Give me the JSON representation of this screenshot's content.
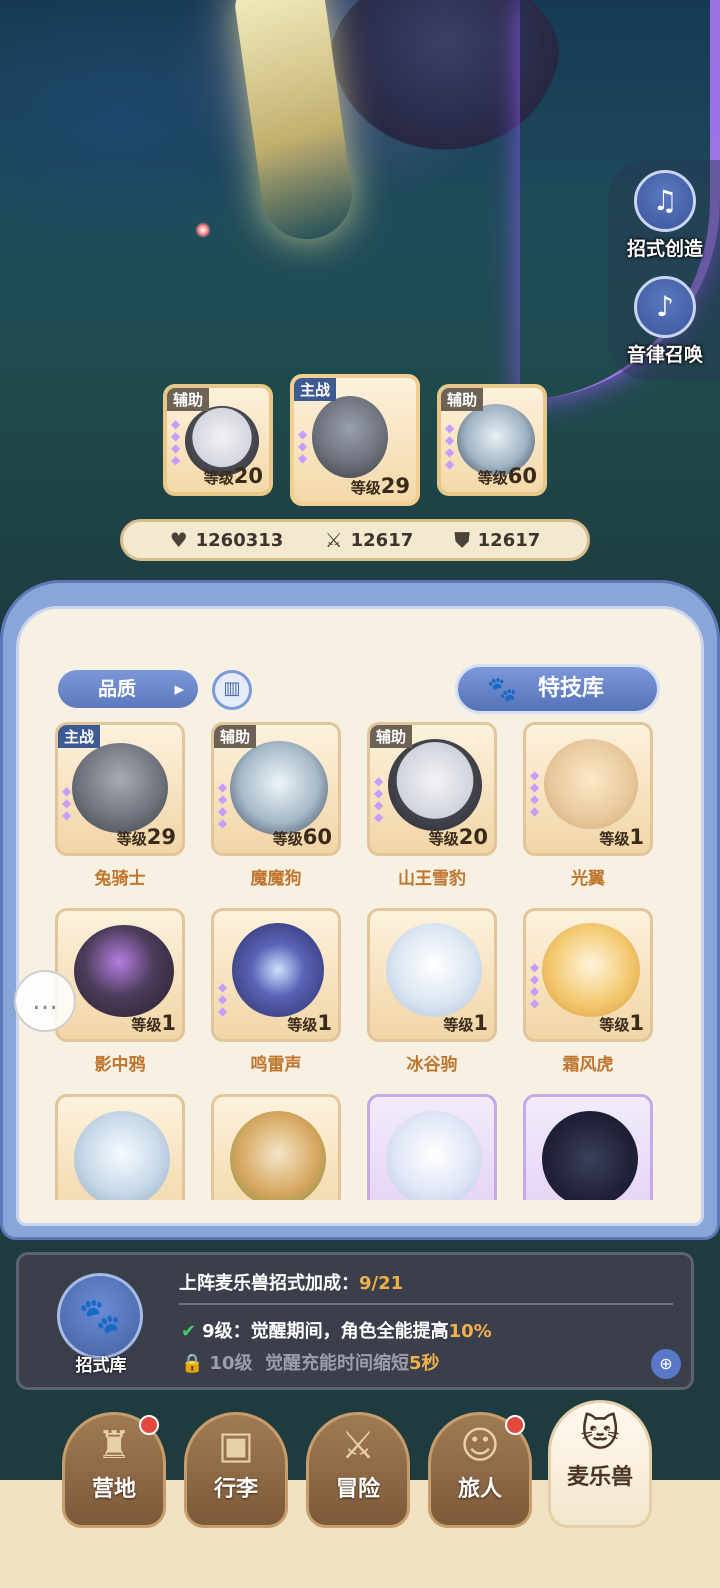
{
  "side_buttons": [
    {
      "label": "招式创造",
      "icon": "music-book-icon"
    },
    {
      "label": "音律召唤",
      "icon": "lyre-icon"
    }
  ],
  "team": [
    {
      "role": "辅助",
      "level_prefix": "等级",
      "level": "20"
    },
    {
      "role": "主战",
      "level_prefix": "等级",
      "level": "29"
    },
    {
      "role": "辅助",
      "level_prefix": "等级",
      "level": "60"
    }
  ],
  "stats": {
    "hp": "1260313",
    "attack": "12617",
    "defense": "12617"
  },
  "filters": {
    "quality_label": "品质",
    "book_icon": "book-icon",
    "skill_library_label": "特技库"
  },
  "pets": [
    {
      "name": "兔骑士",
      "role": "主战",
      "level_prefix": "等级",
      "level": "29"
    },
    {
      "name": "魔魔狗",
      "role": "辅助",
      "level_prefix": "等级",
      "level": "60"
    },
    {
      "name": "山王雪豹",
      "role": "辅助",
      "level_prefix": "等级",
      "level": "20"
    },
    {
      "name": "光翼",
      "role": "",
      "level_prefix": "等级",
      "level": "1"
    },
    {
      "name": "影中鸦",
      "role": "",
      "level_prefix": "等级",
      "level": "1"
    },
    {
      "name": "鸣雷声",
      "role": "",
      "level_prefix": "等级",
      "level": "1"
    },
    {
      "name": "冰谷驹",
      "role": "",
      "level_prefix": "等级",
      "level": "1"
    },
    {
      "name": "霜风虎",
      "role": "",
      "level_prefix": "等级",
      "level": "1"
    }
  ],
  "bonus": {
    "library_label": "招式库",
    "title": "上阵麦乐兽招式加成：",
    "title_value": "9/21",
    "row1_level": "9级：",
    "row1_text": "觉醒期间，角色全能提高",
    "row1_value": "10%",
    "row2_level": "10级",
    "row2_text": "觉醒充能时间缩短",
    "row2_value": "5秒"
  },
  "nav": [
    {
      "label": "营地",
      "badge": true
    },
    {
      "label": "行李",
      "badge": false
    },
    {
      "label": "冒险",
      "badge": false
    },
    {
      "label": "旅人",
      "badge": true
    },
    {
      "label": "麦乐兽",
      "badge": false,
      "active": true
    }
  ],
  "colors": {
    "accent_blue": "#5c79be",
    "name_orange": "#c0762e",
    "highlight": "#f0b14a"
  }
}
